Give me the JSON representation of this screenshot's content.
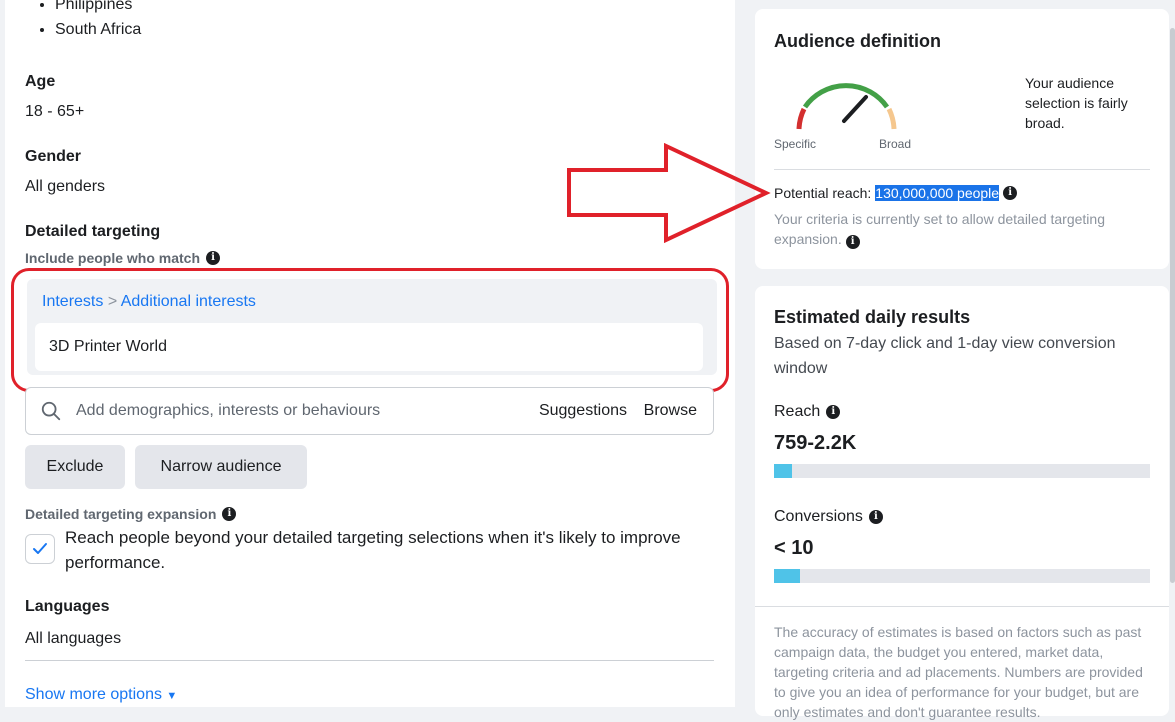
{
  "locations": [
    "Philippines",
    "South Africa"
  ],
  "age": {
    "title": "Age",
    "value": "18 - 65+"
  },
  "gender": {
    "title": "Gender",
    "value": "All genders"
  },
  "detailed_targeting": {
    "title": "Detailed targeting",
    "include_label": "Include people who match",
    "breadcrumb_root": "Interests",
    "breadcrumb_sep": ">",
    "breadcrumb_leaf": "Additional interests",
    "interest": "3D Printer World",
    "search_placeholder": "Add demographics, interests or behaviours",
    "suggestions": "Suggestions",
    "browse": "Browse",
    "exclude": "Exclude",
    "narrow": "Narrow audience"
  },
  "expansion": {
    "label": "Detailed targeting expansion",
    "checkbox_text": "Reach people beyond your detailed targeting selections when it's likely to improve performance.",
    "checked": true
  },
  "languages": {
    "title": "Languages",
    "value": "All languages"
  },
  "show_more": "Show more options",
  "audience": {
    "title": "Audience definition",
    "specific": "Specific",
    "broad": "Broad",
    "note": "Your audience selection is fairly broad.",
    "reach_label": "Potential reach:",
    "reach_value": "130,000,000 people",
    "criteria": "Your criteria is currently set to allow detailed targeting expansion."
  },
  "estimates": {
    "title": "Estimated daily results",
    "subtitle": "Based on 7-day click and 1-day view conversion window",
    "reach_label": "Reach",
    "reach_value": "759-2.2K",
    "reach_fill": 0.048,
    "conversions_label": "Conversions",
    "conversions_value": "< 10",
    "conversions_fill": 0.069,
    "disclaimer": "The accuracy of estimates is based on factors such as past campaign data, the budget you entered, market data, targeting criteria and ad placements. Numbers are provided to give you an idea of performance for your budget, but are only estimates and don't guarantee results."
  },
  "colors": {
    "link": "#1877f2",
    "annotation": "#e0212a",
    "bar": "#4fc3e8"
  }
}
